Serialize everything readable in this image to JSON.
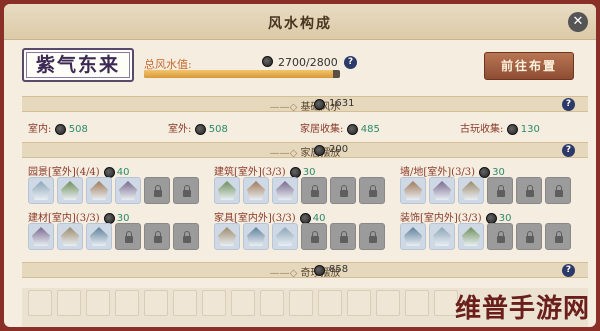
{
  "window": {
    "title": "风水构成",
    "close_icon": "close-icon"
  },
  "seal": {
    "text": "紫气东来"
  },
  "fengshui": {
    "label": "总风水值:",
    "value_text": "2700/2800",
    "current": 2700,
    "max": 2800
  },
  "goto_button": {
    "label": "前往布置"
  },
  "base": {
    "title": "基础风水",
    "value": "1631",
    "stats": [
      {
        "label": "室内:",
        "value": "508"
      },
      {
        "label": "室外:",
        "value": "508"
      },
      {
        "label": "家居收集:",
        "value": "485"
      },
      {
        "label": "古玩收集:",
        "value": "130"
      }
    ]
  },
  "furniture": {
    "title": "家居摆放",
    "value": "200",
    "groups": [
      {
        "label": "园景[室外](4/4)",
        "value": "40",
        "filled": 4
      },
      {
        "label": "建筑[室外](3/3)",
        "value": "30",
        "filled": 3
      },
      {
        "label": "墙/地[室外](3/3)",
        "value": "30",
        "filled": 3
      },
      {
        "label": "建材[室内](3/3)",
        "value": "30",
        "filled": 3
      },
      {
        "label": "家具[室内外](3/3)",
        "value": "40",
        "filled": 3
      },
      {
        "label": "装饰[室内外](3/3)",
        "value": "30",
        "filled": 3
      }
    ]
  },
  "curio": {
    "title": "奇珍摆放",
    "value": "858"
  },
  "watermark": "维普手游网",
  "colors": {
    "accent": "#2e8a6a",
    "label": "#8b3a2a",
    "button": "#9b5a3c"
  }
}
